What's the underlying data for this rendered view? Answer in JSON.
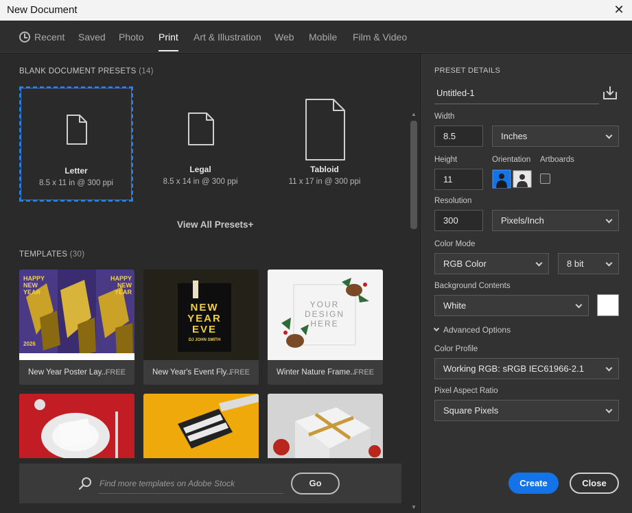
{
  "window": {
    "title": "New Document",
    "close_glyph": "✕"
  },
  "tabs": [
    {
      "label": "Recent",
      "icon": "clock-icon"
    },
    {
      "label": "Saved"
    },
    {
      "label": "Photo"
    },
    {
      "label": "Print",
      "active": true
    },
    {
      "label": "Art & Illustration"
    },
    {
      "label": "Web"
    },
    {
      "label": "Mobile"
    },
    {
      "label": "Film & Video"
    }
  ],
  "blank_presets": {
    "title": "BLANK DOCUMENT PRESETS",
    "count": "(14)",
    "items": [
      {
        "name": "Letter",
        "dims": "8.5 x 11 in @ 300 ppi",
        "selected": true
      },
      {
        "name": "Legal",
        "dims": "8.5 x 14 in @ 300 ppi"
      },
      {
        "name": "Tabloid",
        "dims": "11 x 17 in @ 300 ppi"
      }
    ],
    "view_all": "View All Presets+"
  },
  "templates": {
    "title": "TEMPLATES",
    "count": "(30)",
    "items": [
      {
        "name": "New Year Poster Lay...",
        "price": "FREE",
        "thumb_text": "HAPPY NEW YEAR",
        "thumb_sub": "2026"
      },
      {
        "name": "New Year's Event Fly...",
        "price": "FREE",
        "thumb_text_1": "NEW",
        "thumb_text_2": "YEAR",
        "thumb_text_3": "EVE",
        "thumb_sub": "DJ JOHN SMITH"
      },
      {
        "name": "Winter Nature Frame...",
        "price": "FREE",
        "thumb_text_1": "YOUR",
        "thumb_text_2": "DESIGN",
        "thumb_text_3": "HERE"
      }
    ]
  },
  "search": {
    "placeholder": "Find more templates on Adobe Stock",
    "go_label": "Go"
  },
  "details": {
    "section_title": "PRESET DETAILS",
    "doc_name": "Untitled-1",
    "width_label": "Width",
    "width_value": "8.5",
    "width_unit": "Inches",
    "height_label": "Height",
    "height_value": "11",
    "orientation_label": "Orientation",
    "artboards_label": "Artboards",
    "resolution_label": "Resolution",
    "resolution_value": "300",
    "resolution_unit": "Pixels/Inch",
    "color_mode_label": "Color Mode",
    "color_mode": "RGB Color",
    "bit_depth": "8 bit",
    "bg_label": "Background Contents",
    "bg_value": "White",
    "bg_color": "#ffffff",
    "advanced_label": "Advanced Options",
    "profile_label": "Color Profile",
    "profile_value": "Working RGB: sRGB IEC61966-2.1",
    "aspect_label": "Pixel Aspect Ratio",
    "aspect_value": "Square Pixels"
  },
  "buttons": {
    "create": "Create",
    "close": "Close"
  },
  "colors": {
    "accent": "#1473e6",
    "selection": "#2d7ce2",
    "panel": "#323232"
  }
}
